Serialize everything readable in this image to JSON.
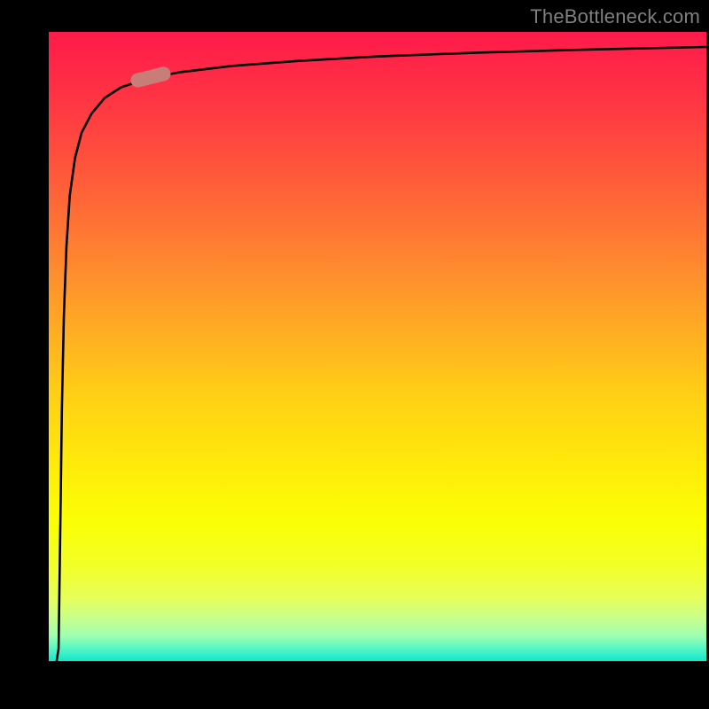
{
  "watermark": "TheBottleneck.com",
  "chart_data": {
    "type": "line",
    "title": "",
    "xlabel": "",
    "ylabel": "",
    "x_range": [
      0,
      100
    ],
    "y_range": [
      0,
      100
    ],
    "series": [
      {
        "name": "curve",
        "x": [
          1.5,
          1.6,
          1.8,
          2.0,
          2.3,
          2.7,
          3.2,
          4.0,
          5.0,
          6.5,
          8.5,
          11,
          15,
          20,
          28,
          38,
          50,
          65,
          82,
          100
        ],
        "values": [
          2,
          10,
          25,
          40,
          55,
          66,
          74,
          80,
          84,
          87,
          89.5,
          91.2,
          92.6,
          93.6,
          94.6,
          95.4,
          96.1,
          96.7,
          97.2,
          97.6
        ]
      }
    ],
    "marker": {
      "x": 15.5,
      "y": 92.8,
      "angle_deg": -14
    },
    "background_gradient": {
      "top": "#ff1a4a",
      "mid": "#ffd015",
      "bottom": "#14e7c8"
    }
  }
}
